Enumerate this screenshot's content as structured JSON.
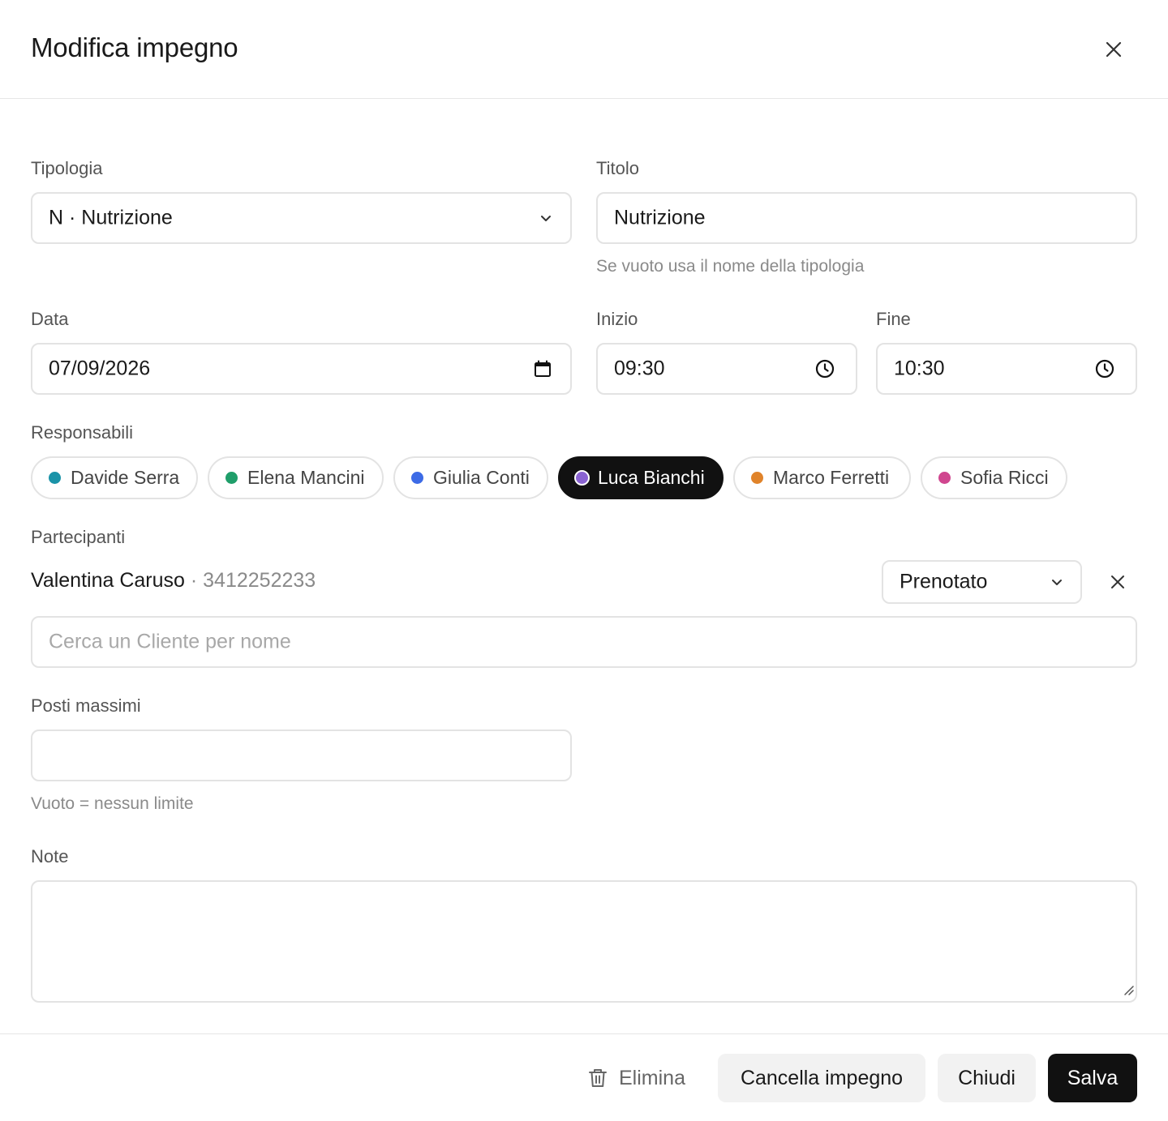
{
  "dialog": {
    "title": "Modifica impegno"
  },
  "form": {
    "tipologia": {
      "label": "Tipologia",
      "value": "N · Nutrizione"
    },
    "titolo": {
      "label": "Titolo",
      "value": "Nutrizione",
      "hint": "Se vuoto usa il nome della tipologia"
    },
    "data": {
      "label": "Data",
      "value": "07/09/2026"
    },
    "inizio": {
      "label": "Inizio",
      "value": "09:30"
    },
    "fine": {
      "label": "Fine",
      "value": "10:30"
    },
    "responsabili": {
      "label": "Responsabili",
      "items": [
        {
          "name": "Davide Serra",
          "color": "#1a93a8",
          "selected": false
        },
        {
          "name": "Elena Mancini",
          "color": "#1f9e6a",
          "selected": false
        },
        {
          "name": "Giulia Conti",
          "color": "#3d6be6",
          "selected": false
        },
        {
          "name": "Luca Bianchi",
          "color": "#8a63d2",
          "selected": true
        },
        {
          "name": "Marco Ferretti",
          "color": "#e0832a",
          "selected": false
        },
        {
          "name": "Sofia Ricci",
          "color": "#d0468f",
          "selected": false
        }
      ]
    },
    "partecipanti": {
      "label": "Partecipanti",
      "items": [
        {
          "name": "Valentina Caruso",
          "separator": " · ",
          "phone": "3412252233",
          "status": "Prenotato"
        }
      ],
      "search_placeholder": "Cerca un Cliente per nome"
    },
    "posti_massimi": {
      "label": "Posti massimi",
      "value": "",
      "hint": "Vuoto = nessun limite"
    },
    "note": {
      "label": "Note",
      "value": ""
    }
  },
  "footer": {
    "delete_label": "Elimina",
    "cancel_event_label": "Cancella impegno",
    "close_label": "Chiudi",
    "save_label": "Salva"
  }
}
